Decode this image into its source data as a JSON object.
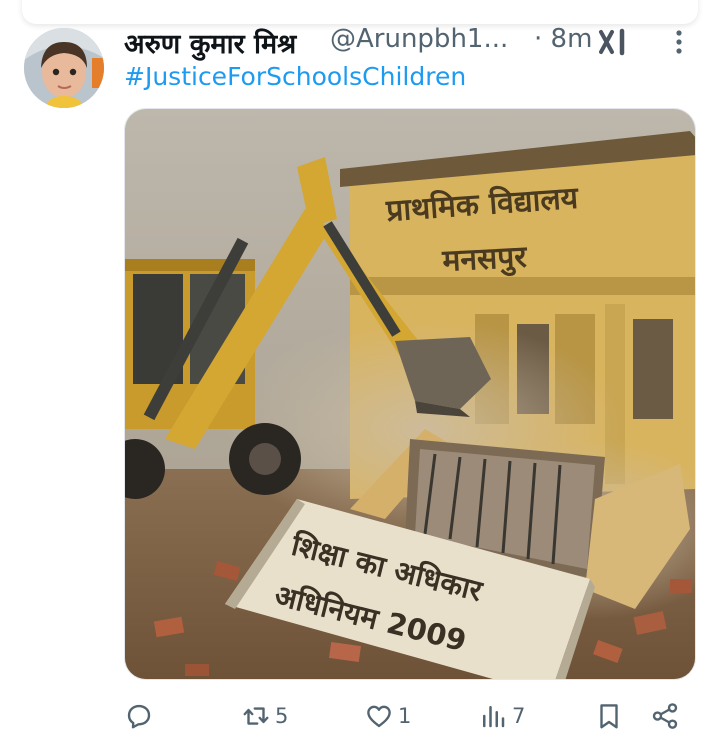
{
  "tweet": {
    "display_name": "अरुण कुमार मिश्र",
    "handle": "@Arunpbh1...",
    "time": "· 8m",
    "hashtag": "#JusticeForSchoolsChildren",
    "media": {
      "building_sign_line1": "प्राथमिक विद्यालय",
      "building_sign_line2": "मनसपुर",
      "slab_line1": "शिक्षा का अधिकार",
      "slab_line2": "अधिनियम 2009"
    },
    "stats": {
      "reposts": "5",
      "likes": "1",
      "views": "7"
    }
  },
  "colors": {
    "accent": "#1d9bf0",
    "secondary_text": "#536471"
  },
  "icons": [
    "grok-icon",
    "more-icon",
    "reply-icon",
    "repost-icon",
    "like-icon",
    "views-icon",
    "bookmark-icon",
    "share-icon"
  ]
}
